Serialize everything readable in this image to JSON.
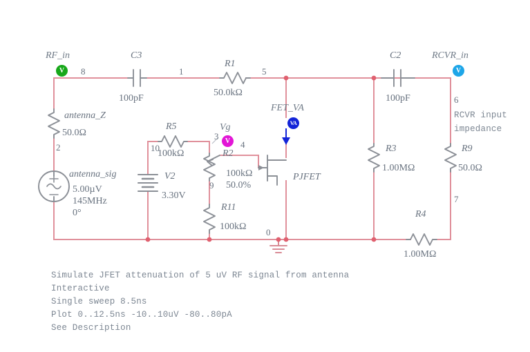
{
  "title": "JFET RF attenuator schematic",
  "colors": {
    "wire": "#e0909b",
    "component": "#8b8f96",
    "text": "#68727f",
    "probe_rf_in": "#17a81a",
    "probe_vg": "#e216d6",
    "probe_fet_va": "#1324d8",
    "probe_rcvr_in": "#1ea6e8",
    "node_dot": "#e0606f"
  },
  "probes": [
    {
      "id": "rf-in",
      "name": "RF_in",
      "glyph": "V",
      "color": "#17a81a"
    },
    {
      "id": "vg",
      "name": "Vg",
      "glyph": "V",
      "color": "#e216d6"
    },
    {
      "id": "fet-va",
      "name": "FET_VA",
      "glyph": "VA",
      "color": "#1324d8"
    },
    {
      "id": "rcvr-in",
      "name": "RCVR_in",
      "glyph": "V",
      "color": "#1ea6e8"
    }
  ],
  "components": {
    "C3": {
      "ref": "C3",
      "value": "100pF",
      "type": "capacitor"
    },
    "C2": {
      "ref": "C2",
      "value": "100pF",
      "type": "capacitor"
    },
    "R1": {
      "ref": "R1",
      "value": "50.0kΩ",
      "type": "resistor"
    },
    "R5": {
      "ref": "R5",
      "value": "100kΩ",
      "type": "resistor"
    },
    "R2": {
      "ref": "R2",
      "value": "100kΩ",
      "value2": "50.0%",
      "type": "potentiometer"
    },
    "R11": {
      "ref": "R11",
      "value": "100kΩ",
      "type": "resistor"
    },
    "R3": {
      "ref": "R3",
      "value": "1.00MΩ",
      "type": "resistor"
    },
    "R9": {
      "ref": "R9",
      "value": "50.0Ω",
      "type": "resistor"
    },
    "R4": {
      "ref": "R4",
      "value": "1.00MΩ",
      "type": "resistor"
    },
    "antenna_Z": {
      "ref": "antenna_Z",
      "value": "50.0Ω",
      "type": "resistor"
    },
    "antenna_sig": {
      "ref": "antenna_sig",
      "value": "5.00µV",
      "value2": "145MHz",
      "value3": "0°",
      "type": "ac-source"
    },
    "V2": {
      "ref": "V2",
      "value": "3.30V",
      "type": "battery"
    },
    "PJFET": {
      "ref": "PJFET",
      "type": "p-channel-jfet"
    }
  },
  "nodes": [
    {
      "id": "8",
      "label": "8"
    },
    {
      "id": "1",
      "label": "1"
    },
    {
      "id": "5",
      "label": "5"
    },
    {
      "id": "6",
      "label": "6"
    },
    {
      "id": "2",
      "label": "2"
    },
    {
      "id": "10",
      "label": "10"
    },
    {
      "id": "3",
      "label": "3"
    },
    {
      "id": "4",
      "label": "4"
    },
    {
      "id": "9",
      "label": "9"
    },
    {
      "id": "7",
      "label": "7"
    },
    {
      "id": "0",
      "label": "0"
    }
  ],
  "annotations": {
    "rcvr_impedance_line1": "RCVR input",
    "rcvr_impedance_line2": "impedance"
  },
  "footer": {
    "lines": [
      "Simulate JFET attenuation of 5 uV RF signal from antenna",
      "Interactive",
      "Single sweep 8.5ns",
      "Plot 0..12.5ns -10..10uV -80..80pA",
      "See Description"
    ]
  }
}
